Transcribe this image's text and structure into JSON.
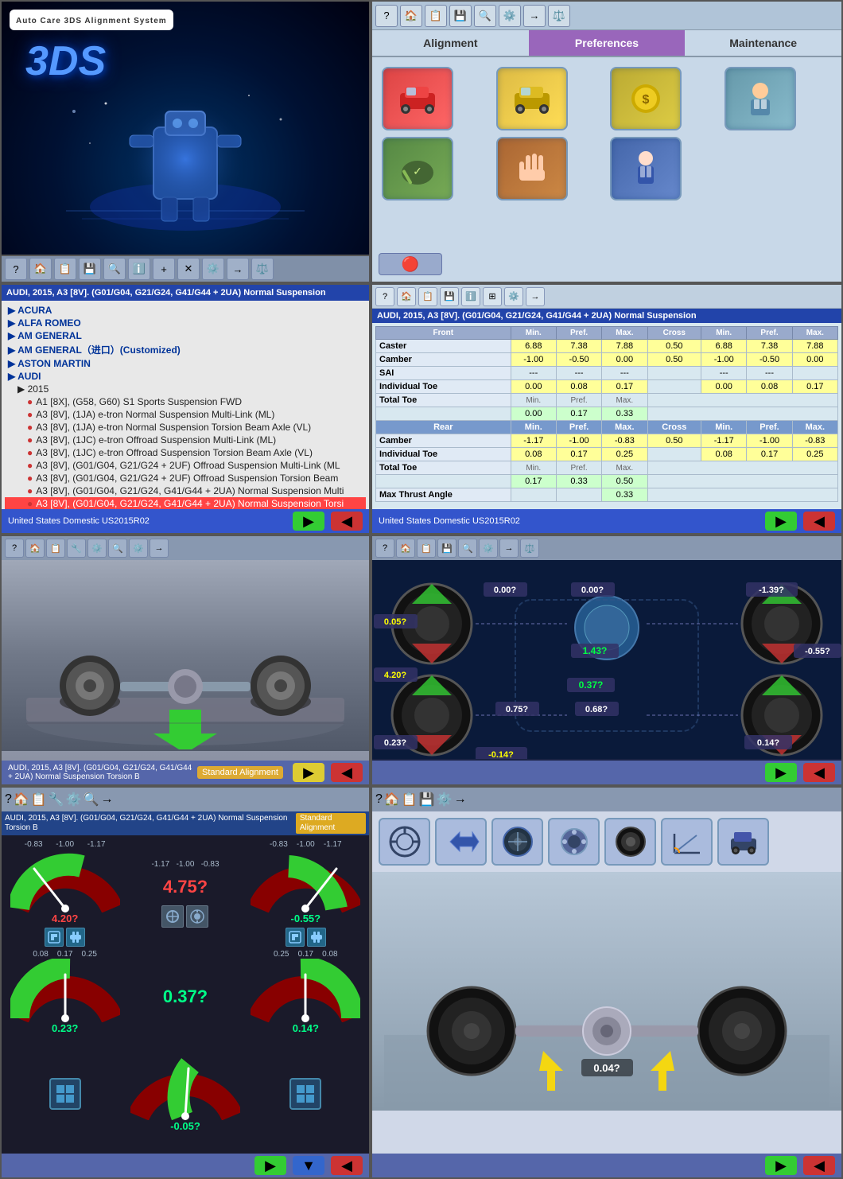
{
  "app": {
    "title": "Auto Care 3DS Alignment System"
  },
  "panels": {
    "top_left": {
      "logo": "AUTO CARE",
      "brand": "3DS",
      "toolbar_buttons": [
        "?",
        "🏠",
        "📋",
        "💾",
        "🔍",
        "ℹ️",
        "+",
        "✕",
        "⚙️",
        "→",
        "⚖️"
      ]
    },
    "top_right": {
      "tabs": [
        {
          "id": "alignment",
          "label": "Alignment",
          "active": false
        },
        {
          "id": "preferences",
          "label": "Preferences",
          "active": true
        },
        {
          "id": "maintenance",
          "label": "Maintenance",
          "active": false
        }
      ],
      "toolbar_buttons": [
        "?",
        "🏠",
        "📋",
        "💾",
        "🔍",
        "⚙️",
        "→",
        "⚖️"
      ],
      "icons": [
        {
          "id": "car-red",
          "icon": "🚗",
          "label": "Car settings"
        },
        {
          "id": "car-yellow",
          "icon": "🚕",
          "label": "Vehicle data"
        },
        {
          "id": "coin",
          "icon": "💰",
          "label": "Pricing"
        },
        {
          "id": "mechanic",
          "icon": "👨‍🔧",
          "label": "Mechanic"
        },
        {
          "id": "wrench",
          "icon": "🔧",
          "label": "Tools"
        },
        {
          "id": "hand",
          "icon": "🖐️",
          "label": "Manual"
        },
        {
          "id": "person",
          "icon": "👔",
          "label": "User"
        }
      ]
    },
    "middle_left": {
      "title": "AUDI, 2015, A3 [8V]. (G01/G04, G21/G24, G41/G44 + 2UA) Normal Suspension",
      "brands": [
        "ACURA",
        "ALFA ROMEO",
        "AM GENERAL",
        "AM GENERAL（进口）(Customized)",
        "ASTON MARTIN",
        "AUDI"
      ],
      "years": [
        "2015"
      ],
      "models": [
        "A1 [8X], (G58, G60) S1 Sports Suspension FWD",
        "A3 [8V], (1JA) e-tron Normal Suspension Multi-Link (ML)",
        "A3 [8V], (1JA) e-tron Normal Suspension Torsion Beam Axle (VL)",
        "A3 [8V], (1JC) e-tron Offroad Suspension Multi-Link (ML)",
        "A3 [8V], (1JC) e-tron Offroad Suspension Torsion Beam Axle (VL)",
        "A3 [8V], (G01/G04, G21/G24 + 2UF) Offroad Suspension Multi-Link (ML",
        "A3 [8V], (G01/G04, G21/G24 + 2UF) Offroad Suspension Torsion Beam",
        "A3 [8V], (G01/G04, G21/G24, G41/G44 + 2UA) Normal Suspension Multi",
        "A3 [8V], (G01/G04, G21/G24, G41/G44 + 2UA) Normal Suspension Torsi"
      ],
      "selected_model": "A3 [8V], (G01/G04, G21/G24, G41/G44 + 2UA) Normal Suspension Torsi",
      "status": "United States Domestic US2015R02"
    },
    "middle_right": {
      "title": "AUDI, 2015, A3 [8V]. (G01/G04, G21/G24, G41/G44 + 2UA) Normal Suspension",
      "front": {
        "headers": [
          "Front",
          "Min.",
          "Pref.",
          "Max.",
          "Cross",
          "Min.",
          "Pref.",
          "Max."
        ],
        "rows": [
          {
            "label": "Caster",
            "min": "6.88",
            "pref": "7.38",
            "max": "7.88",
            "cross": "0.50",
            "min2": "6.88",
            "pref2": "7.38",
            "max2": "7.88"
          },
          {
            "label": "Camber",
            "min": "-1.00",
            "pref": "-0.50",
            "max": "0.00",
            "cross": "0.50",
            "min2": "-1.00",
            "pref2": "-0.50",
            "max2": "0.00"
          },
          {
            "label": "SAI",
            "min": "---",
            "pref": "---",
            "max": "---",
            "cross": "",
            "min2": "---",
            "pref2": "---",
            "max2": ""
          },
          {
            "label": "Individual Toe",
            "min": "0.00",
            "pref": "0.08",
            "max": "0.17",
            "cross": "",
            "min2": "0.00",
            "pref2": "0.08",
            "max2": "0.17"
          }
        ],
        "total_toe": {
          "min": "0.00",
          "pref": "0.17",
          "max": "0.33"
        }
      },
      "rear": {
        "headers": [
          "Rear",
          "Min.",
          "Pref.",
          "Max.",
          "Cross",
          "Min.",
          "Pref.",
          "Max."
        ],
        "rows": [
          {
            "label": "Camber",
            "min": "-1.17",
            "pref": "-1.00",
            "max": "-0.83",
            "cross": "0.50",
            "min2": "-1.17",
            "pref2": "-1.00",
            "max2": "-0.83"
          },
          {
            "label": "Individual Toe",
            "min": "0.08",
            "pref": "0.17",
            "max": "0.25",
            "cross": "",
            "min2": "0.08",
            "pref2": "0.17",
            "max2": "0.25"
          }
        ],
        "total_toe": {
          "min": "0.17",
          "pref": "0.33",
          "max": "0.50"
        },
        "max_thrust_angle": "0.33"
      },
      "status": "United States Domestic US2015R02"
    },
    "wheel_view": {
      "title": "AUDI, 2015, A3 [8V] Normal Suspension Torsion B",
      "subtitle": "Standard Alignment"
    },
    "alignment_visual": {
      "values": {
        "top_left": "0.05?",
        "top_center_left": "0.00?",
        "top_center_right": "0.00?",
        "top_right": "-1.39?",
        "left": "4.20?",
        "center": "1.43?",
        "right": "-0.55?",
        "center_left": "0.75?",
        "center_right": "0.68?",
        "lower_center": "0.37?",
        "bottom_left": "0.23?",
        "bottom_right": "0.14?",
        "bottom_neg": "-0.14?"
      }
    },
    "gauges": {
      "title": "AUDI, 2015, A3 [8V]. (G01/G04, G21/G24, G41/G44 + 2UA) Normal Suspension Torsion B",
      "values": [
        {
          "id": "fl-camber",
          "label": "4.20?",
          "color": "red",
          "position": "front-left"
        },
        {
          "id": "center-caster",
          "label": "4.75?",
          "color": "red",
          "position": "center"
        },
        {
          "id": "fr-camber",
          "label": "-0.55?",
          "color": "green",
          "position": "front-right"
        },
        {
          "id": "rl-toe",
          "label": "0.23?",
          "color": "green",
          "position": "rear-left"
        },
        {
          "id": "center-toe",
          "label": "0.37?",
          "color": "green",
          "position": "center"
        },
        {
          "id": "rr-toe",
          "label": "0.14?",
          "color": "green",
          "position": "rear-right"
        },
        {
          "id": "center-neg",
          "label": "-0.05?",
          "color": "green",
          "position": "bottom-center"
        }
      ],
      "scale_min": "-0.83",
      "scale_max": "0.83",
      "fl_scale_min": "-1.00",
      "fl_scale_max": "0.25",
      "fr_scale_min": "0.25",
      "fr_scale_max": "-0.83"
    },
    "alignment_icons": {
      "toolbar_buttons": [
        "?",
        "🏠",
        "📋",
        "💾",
        "🔍",
        "⚙️",
        "→",
        "⚖️"
      ],
      "icon_buttons": [
        "🚗",
        "📏",
        "🔄",
        "⚙️",
        "🔧",
        "📐",
        "🚙"
      ],
      "car_value": "0.04?"
    }
  }
}
